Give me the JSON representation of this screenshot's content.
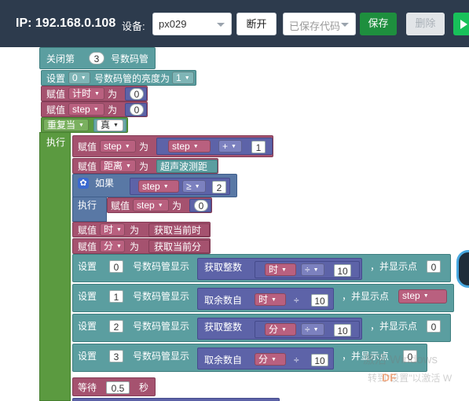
{
  "toolbar": {
    "ip": "IP: 192.168.0.108",
    "device_label": "设备:",
    "device_value": "px029",
    "disconnect": "断开",
    "saved_code_placeholder": "已保存代码",
    "save": "保存",
    "delete": "删除"
  },
  "blocks": {
    "close_a": "关闭第",
    "close_num": "3",
    "close_b": "号数码管",
    "brightness_a": "设置",
    "brightness_idx": "0",
    "brightness_b": "号数码管的亮度为",
    "brightness_val": "1",
    "assign": "赋值",
    "as": "为",
    "var_timer": "计时",
    "zero": "0",
    "var_step": "step",
    "repeat": "重复当",
    "true_val": "真",
    "do": "执行",
    "plus": "+",
    "one": "1",
    "var_distance": "距离",
    "ultrasonic": "超声波测距",
    "if": "如果",
    "gte": "≥",
    "two": "2",
    "var_hour": "时",
    "get_hour": "获取当前时",
    "var_minute": "分",
    "get_minute": "获取当前分",
    "set": "设置",
    "disp_num_show": "号数码管显示",
    "get_integer": "获取整数",
    "get_remainder": "取余数自",
    "div": "÷",
    "ten": "10",
    "dot_show": "，并显示点",
    "idx0": "0",
    "idx1": "1",
    "idx2": "2",
    "idx3": "3",
    "wait": "等待",
    "wait_val": "0.5",
    "seconds": "秒"
  },
  "watermark": {
    "windows": "激活 Windows",
    "windows_sub": "转到\"设置\"以激活 W",
    "df": "DF"
  }
}
